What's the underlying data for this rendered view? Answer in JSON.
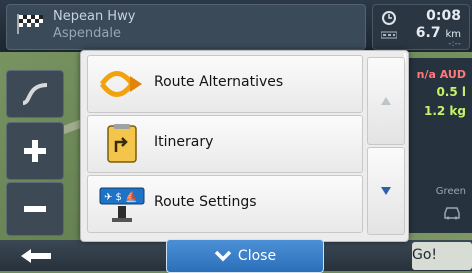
{
  "header": {
    "street_line1": "Nepean Hwy",
    "street_line2": "Aspendale",
    "time": "0:08",
    "distance_value": "6.7",
    "distance_unit": "km",
    "dash_placeholder": "-:--"
  },
  "right_panel": {
    "cost": "n/a AUD",
    "value1": "0.5 l",
    "value2": "1.2 kg",
    "label_green": "Green"
  },
  "menu": {
    "items": [
      {
        "label": "Route Alternatives",
        "icon": "route-alternatives-icon"
      },
      {
        "label": "Itinerary",
        "icon": "itinerary-icon"
      },
      {
        "label": "Route Settings",
        "icon": "route-settings-icon"
      }
    ],
    "close_label": "Close"
  },
  "bottombar": {
    "go_label": "Go!"
  },
  "colors": {
    "accent_blue": "#2a6fb9",
    "highlight_green": "#c4f26a",
    "warning_red": "#ff7a7a"
  }
}
